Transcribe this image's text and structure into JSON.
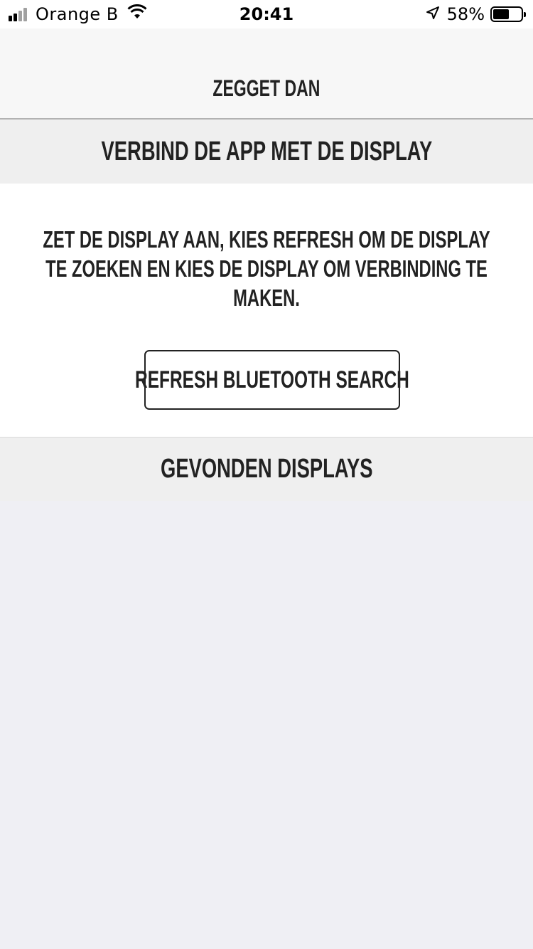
{
  "status_bar": {
    "carrier": "Orange B",
    "time": "20:41",
    "battery_percent": "58%",
    "battery_level": 0.58,
    "signal_bars_filled": 2,
    "signal_bars_total": 4,
    "icons": [
      "signal-icon",
      "wifi-icon",
      "location-arrow-icon",
      "battery-icon"
    ]
  },
  "nav": {
    "title": "Zegget Dan"
  },
  "sections": {
    "connect_title": "Verbind de app met de display",
    "found_title": "Gevonden displays"
  },
  "main": {
    "instructions": "Zet de display aan, kies refresh om de display te zoeken en kies de display om verbinding te maken.",
    "refresh_button_label": "Refresh Bluetooth Search"
  },
  "found_displays": [],
  "colors": {
    "text": "#222222",
    "section_bg": "#efefef",
    "background": "#efeff4"
  }
}
